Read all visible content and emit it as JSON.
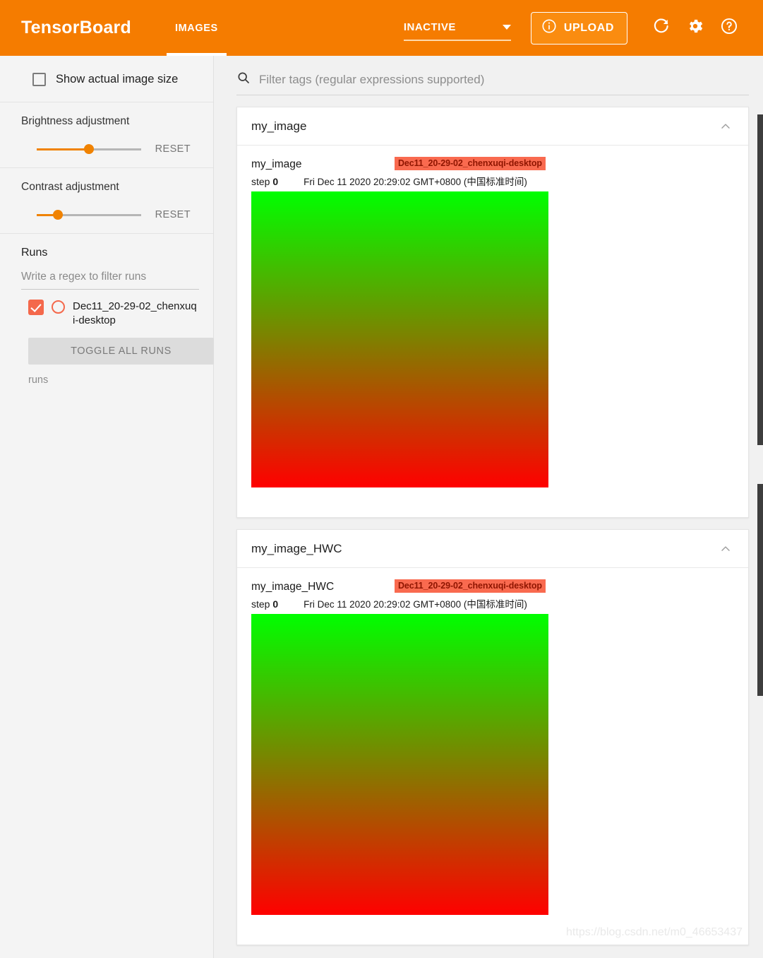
{
  "header": {
    "brand": "TensorBoard",
    "tabs": [
      {
        "label": "IMAGES",
        "active": true
      }
    ],
    "runs_selector": {
      "value": "INACTIVE",
      "caret_icon": "caret-down-icon"
    },
    "upload_button": {
      "label": "UPLOAD",
      "icon": "info-circle-icon"
    },
    "icons": [
      {
        "name": "refresh-icon"
      },
      {
        "name": "gear-icon"
      },
      {
        "name": "help-circle-icon"
      }
    ],
    "accent_color": "#f57c00"
  },
  "sidebar": {
    "show_actual_image_size": {
      "label": "Show actual image size",
      "checked": false
    },
    "brightness": {
      "label": "Brightness adjustment",
      "reset_label": "RESET",
      "value_pct": 50
    },
    "contrast": {
      "label": "Contrast adjustment",
      "reset_label": "RESET",
      "value_pct": 20
    },
    "runs": {
      "title": "Runs",
      "filter_placeholder": "Write a regex to filter runs",
      "filter_value": "",
      "items": [
        {
          "name": "Dec11_20-29-02_chenxuqi-desktop",
          "checked": true,
          "color": "#f4684b"
        }
      ],
      "toggle_all_label": "TOGGLE ALL RUNS",
      "footer_label": "runs"
    }
  },
  "main": {
    "filter": {
      "icon": "search-icon",
      "placeholder": "Filter tags (regular expressions supported)",
      "value": ""
    },
    "cards": [
      {
        "title": "my_image",
        "collapse_icon": "chevron-up-icon",
        "image": {
          "tag": "my_image",
          "run_badge": "Dec11_20-29-02_chenxuqi-desktop",
          "step_label": "step",
          "step_value": "0",
          "timestamp": "Fri Dec 11 2020 20:29:02 GMT+0800 (中国标准时间)",
          "gradient_top": "#00ff00",
          "gradient_bottom": "#ff0000"
        }
      },
      {
        "title": "my_image_HWC",
        "collapse_icon": "chevron-up-icon",
        "image": {
          "tag": "my_image_HWC",
          "run_badge": "Dec11_20-29-02_chenxuqi-desktop",
          "step_label": "step",
          "step_value": "0",
          "timestamp": "Fri Dec 11 2020 20:29:02 GMT+0800 (中国标准时间)",
          "gradient_top": "#00ff00",
          "gradient_bottom": "#ff0000"
        }
      }
    ]
  },
  "watermark": "https://blog.csdn.net/m0_46653437"
}
